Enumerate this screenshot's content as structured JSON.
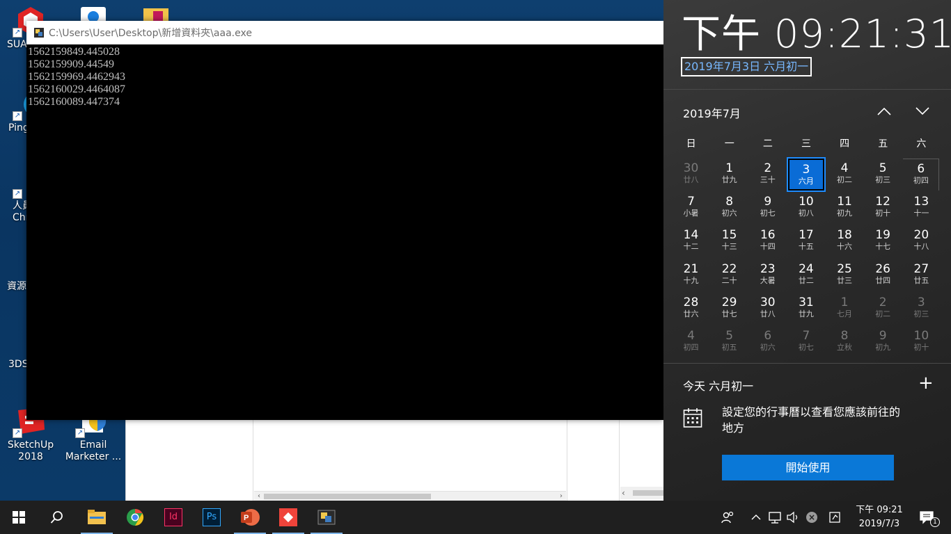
{
  "desktop": {
    "icons": [
      {
        "label": "SUA"
      },
      {
        "label": "Ping"
      },
      {
        "label": "人員\nChr"
      },
      {
        "label": "資源"
      },
      {
        "label": "3DS"
      },
      {
        "label": "SketchUp 2018"
      },
      {
        "label": "Email Marketer ..."
      }
    ]
  },
  "console": {
    "title": "C:\\Users\\User\\Desktop\\新增資料夾\\aaa.exe",
    "lines": [
      "1562159849.445028",
      "1562159909.44549",
      "1562159969.4462943",
      "1562160029.4464087",
      "1562160089.447374"
    ]
  },
  "flyout": {
    "time": "下午 09:21:31",
    "date_long": "2019年7月3日 六月初一",
    "month_label": "2019年7月",
    "weekdays": [
      "日",
      "一",
      "二",
      "三",
      "四",
      "五",
      "六"
    ],
    "days": [
      {
        "d": "30",
        "l": "廿八",
        "dim": true
      },
      {
        "d": "1",
        "l": "廿九"
      },
      {
        "d": "2",
        "l": "三十"
      },
      {
        "d": "3",
        "l": "六月",
        "today": true
      },
      {
        "d": "4",
        "l": "初二"
      },
      {
        "d": "5",
        "l": "初三"
      },
      {
        "d": "6",
        "l": "初四"
      },
      {
        "d": "7",
        "l": "小暑"
      },
      {
        "d": "8",
        "l": "初六"
      },
      {
        "d": "9",
        "l": "初七"
      },
      {
        "d": "10",
        "l": "初八"
      },
      {
        "d": "11",
        "l": "初九"
      },
      {
        "d": "12",
        "l": "初十"
      },
      {
        "d": "13",
        "l": "十一"
      },
      {
        "d": "14",
        "l": "十二"
      },
      {
        "d": "15",
        "l": "十三"
      },
      {
        "d": "16",
        "l": "十四"
      },
      {
        "d": "17",
        "l": "十五"
      },
      {
        "d": "18",
        "l": "十六"
      },
      {
        "d": "19",
        "l": "十七"
      },
      {
        "d": "20",
        "l": "十八"
      },
      {
        "d": "21",
        "l": "十九"
      },
      {
        "d": "22",
        "l": "二十"
      },
      {
        "d": "23",
        "l": "大暑"
      },
      {
        "d": "24",
        "l": "廿二"
      },
      {
        "d": "25",
        "l": "廿三"
      },
      {
        "d": "26",
        "l": "廿四"
      },
      {
        "d": "27",
        "l": "廿五"
      },
      {
        "d": "28",
        "l": "廿六"
      },
      {
        "d": "29",
        "l": "廿七"
      },
      {
        "d": "30",
        "l": "廿八"
      },
      {
        "d": "31",
        "l": "廿九"
      },
      {
        "d": "1",
        "l": "七月",
        "dim": true
      },
      {
        "d": "2",
        "l": "初二",
        "dim": true
      },
      {
        "d": "3",
        "l": "初三",
        "dim": true
      },
      {
        "d": "4",
        "l": "初四",
        "dim": true
      },
      {
        "d": "5",
        "l": "初五",
        "dim": true
      },
      {
        "d": "6",
        "l": "初六",
        "dim": true
      },
      {
        "d": "7",
        "l": "初七",
        "dim": true
      },
      {
        "d": "8",
        "l": "立秋",
        "dim": true
      },
      {
        "d": "9",
        "l": "初九",
        "dim": true
      },
      {
        "d": "10",
        "l": "初十",
        "dim": true
      }
    ],
    "agenda_title": "今天 六月初一",
    "agenda_text": "設定您的行事曆以查看您應該前往的地方",
    "start_button": "開始使用",
    "accent": "#0a78d7"
  },
  "taskbar": {
    "apps": [
      {
        "name": "start-button"
      },
      {
        "name": "search-button"
      },
      {
        "name": "file-explorer"
      },
      {
        "name": "chrome"
      },
      {
        "name": "indesign"
      },
      {
        "name": "photoshop"
      },
      {
        "name": "powerpoint"
      },
      {
        "name": "anydesk"
      },
      {
        "name": "python"
      }
    ],
    "clock_time": "下午 09:21",
    "clock_date": "2019/7/3",
    "notification_count": "1"
  }
}
